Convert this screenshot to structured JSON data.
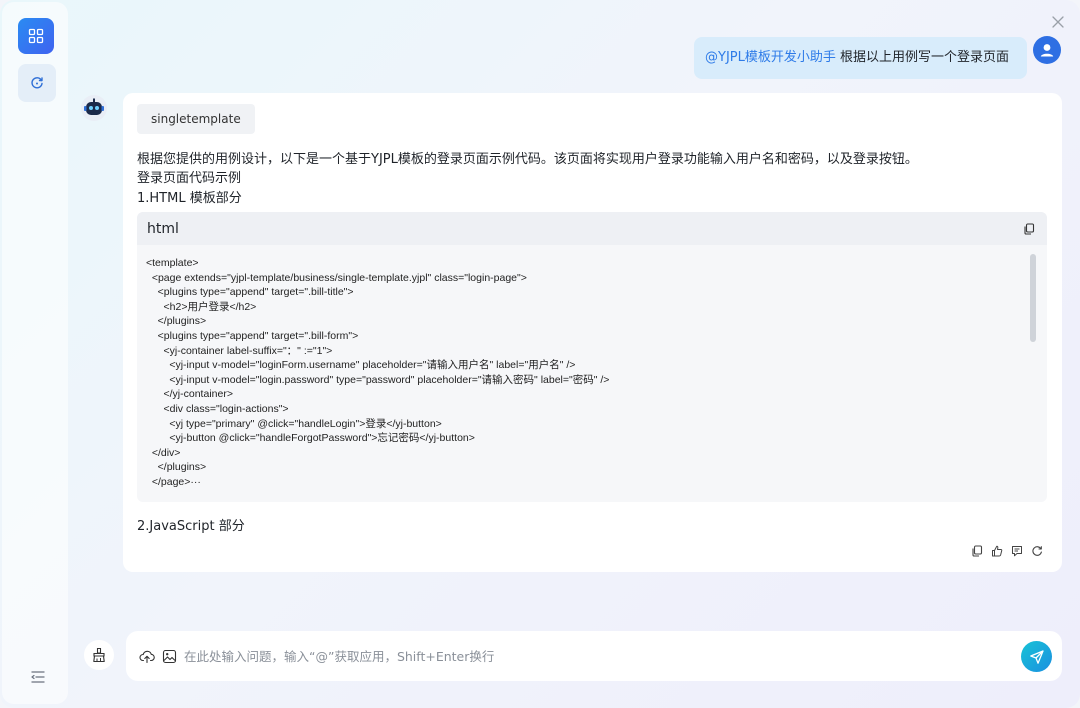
{
  "user_message": {
    "mention": "@YJPL模板开发小助手",
    "text": " 根据以上用例写一个登录页面"
  },
  "bot_message": {
    "tag": "singletemplate",
    "intro": "根据您提供的用例设计，以下是一个基于YJPL模板的登录页面示例代码。该页面将实现用户登录功能输入用户名和密码，以及登录按钮。",
    "heading": "登录页面代码示例",
    "section1": "1.HTML 模板部分",
    "code_lang": "html",
    "code_lines": [
      "<template>",
      "  <page extends=\"yjpl-template/business/single-template.yjpl\" class=\"login-page\">",
      "    <plugins type=\"append\" target=\".bill-title\">",
      "      <h2>用户登录</h2>",
      "    </plugins>",
      "    <plugins type=\"append\" target=\".bill-form\">",
      "      <yj-container label-suffix=\"：\" :=\"1\">",
      "        <yj-input v-model=\"loginForm.username\" placeholder=\"请输入用户名\" label=\"用户名\" />",
      "        <yj-input v-model=\"login.password\" type=\"password\" placeholder=\"请输入密码\" label=\"密码\" />",
      "      </yj-container>",
      "      <div class=\"login-actions\">",
      "        <yj type=\"primary\" @click=\"handleLogin\">登录</yj-button>",
      "        <yj-button @click=\"handleForgotPassword\">忘记密码</yj-button>",
      "  </div>",
      "    </plugins>",
      "  </page>···"
    ],
    "section2": "2.JavaScript 部分"
  },
  "input": {
    "placeholder": "在此处输入问题，输入“@”获取应用，Shift+Enter换行",
    "value": ""
  },
  "icons": {
    "rail_logo": "app-grid-icon",
    "rail_chat": "chat-refresh-icon",
    "rail_collapse": "menu-collapse-icon",
    "close": "close-icon",
    "user_avatar": "user-icon",
    "bot_avatar": "robot-icon",
    "copy": "copy-icon",
    "like": "thumbs-up-icon",
    "comment": "comment-icon",
    "regenerate": "refresh-icon",
    "clean": "broom-icon",
    "upload": "cloud-upload-icon",
    "image": "image-icon",
    "send": "send-icon"
  },
  "colors": {
    "accent": "#2e7be8",
    "user_bubble": "#d8ecfb",
    "send_button": "#1aa8dc"
  }
}
